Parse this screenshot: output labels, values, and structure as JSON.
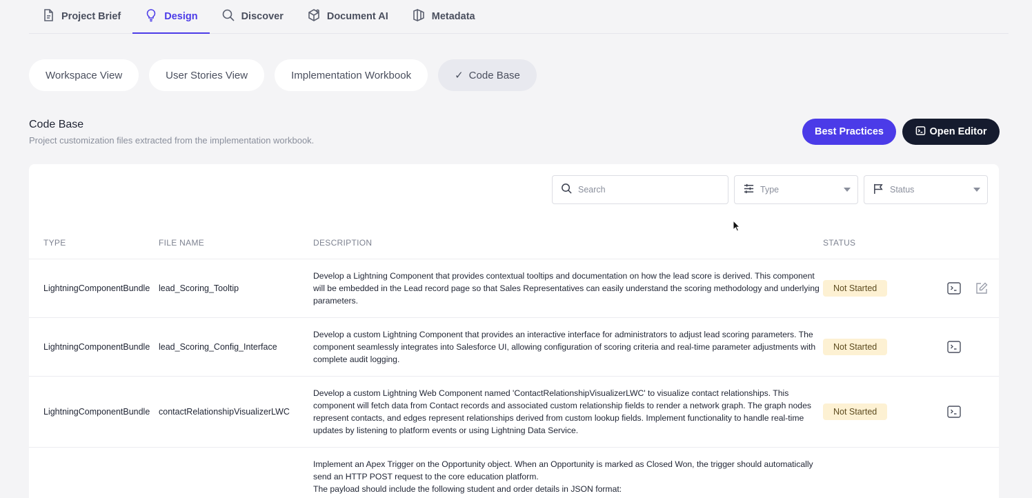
{
  "nav": {
    "tabs": [
      {
        "label": "Project Brief",
        "icon": "document-icon"
      },
      {
        "label": "Design",
        "icon": "lightbulb-icon",
        "active": true
      },
      {
        "label": "Discover",
        "icon": "search-icon"
      },
      {
        "label": "Document AI",
        "icon": "cube-icon"
      },
      {
        "label": "Metadata",
        "icon": "layers-icon"
      }
    ]
  },
  "views": {
    "pills": [
      {
        "label": "Workspace View"
      },
      {
        "label": "User Stories View"
      },
      {
        "label": "Implementation Workbook"
      },
      {
        "label": "Code Base",
        "active": true,
        "check": "✓"
      }
    ]
  },
  "section": {
    "title": "Code Base",
    "subtitle": "Project customization files extracted from the implementation workbook.",
    "best_practices_label": "Best Practices",
    "open_editor_label": "Open Editor"
  },
  "filters": {
    "search_placeholder": "Search",
    "type_label": "Type",
    "status_label": "Status"
  },
  "table": {
    "headers": {
      "type": "TYPE",
      "file": "FILE NAME",
      "description": "DESCRIPTION",
      "status": "STATUS"
    },
    "rows": [
      {
        "type": "LightningComponentBundle",
        "file": "lead_Scoring_Tooltip",
        "description": "Develop a Lightning Component that provides contextual tooltips and documentation on how the lead score is derived. This component will be embedded in the Lead record page so that Sales Representatives can easily understand the scoring methodology and underlying parameters.",
        "status": "Not Started"
      },
      {
        "type": "LightningComponentBundle",
        "file": "lead_Scoring_Config_Interface",
        "description": "Develop a custom Lightning Component that provides an interactive interface for administrators to adjust lead scoring parameters. The component seamlessly integrates into Salesforce UI, allowing configuration of scoring criteria and real-time parameter adjustments with complete audit logging.",
        "status": "Not Started"
      },
      {
        "type": "LightningComponentBundle",
        "file": "contactRelationshipVisualizerLWC",
        "description": "Develop a custom Lightning Web Component named 'ContactRelationshipVisualizerLWC' to visualize contact relationships. This component will fetch data from Contact records and associated custom relationship fields to render a network graph. The graph nodes represent contacts, and edges represent relationships derived from custom lookup fields. Implement functionality to handle real-time updates by listening to platform events or using Lightning Data Service.",
        "status": "Not Started"
      },
      {
        "type": "",
        "file": "",
        "description": "Implement an Apex Trigger on the Opportunity object. When an Opportunity is marked as Closed Won, the trigger should automatically send an HTTP POST request to the core education platform.\nThe payload should include the following student and order details in JSON format:",
        "status": ""
      }
    ]
  },
  "colors": {
    "accent": "#4b3be8",
    "dark_button": "#151b2e",
    "status_badge_bg": "#fdf1d3"
  }
}
